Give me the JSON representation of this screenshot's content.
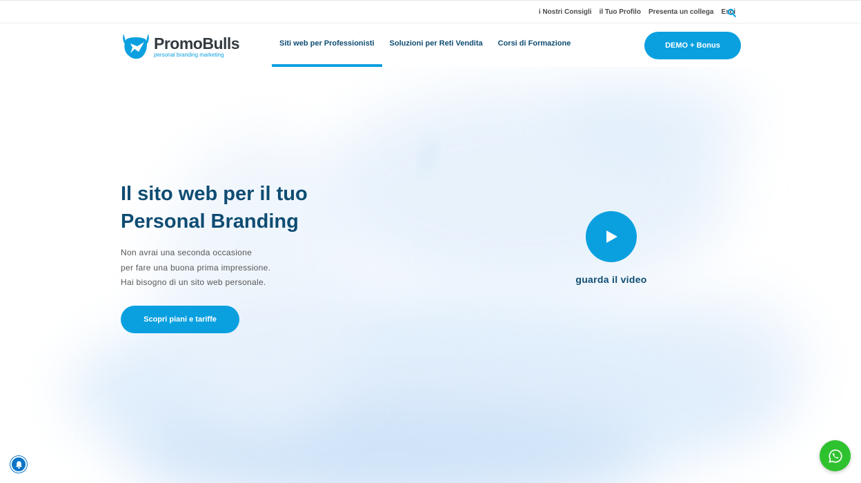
{
  "topbar": {
    "links": [
      "i Nostri Consigli",
      "il Tuo Profilo",
      "Presenta un collega",
      "Esci"
    ],
    "search_icon": "search-icon"
  },
  "header": {
    "logo": {
      "name": "PromoBulls",
      "tagline": "personal branding marketing"
    },
    "nav": [
      {
        "label": "Siti web per Professionisti",
        "active": true
      },
      {
        "label": "Soluzioni per Reti Vendita",
        "active": false
      },
      {
        "label": "Corsi di Formazione",
        "active": false
      }
    ],
    "demo_button": "DEMO + Bonus"
  },
  "hero": {
    "title_lines": [
      "Il sito web per il tuo",
      "Personal Branding"
    ],
    "text_lines": [
      "Non avrai una seconda occasione",
      "per fare una buona prima impressione.",
      "Hai bisogno di un sito web personale."
    ],
    "cta": "Scopri piani e tariffe",
    "video_label": "guarda il video"
  },
  "floating": {
    "bell_icon": "bell-icon",
    "whatsapp_icon": "whatsapp-icon"
  },
  "colors": {
    "accent": "#0aa0e0",
    "dark_blue": "#0e4c72",
    "whatsapp": "#2fc22f",
    "bell": "#0a74c8"
  }
}
